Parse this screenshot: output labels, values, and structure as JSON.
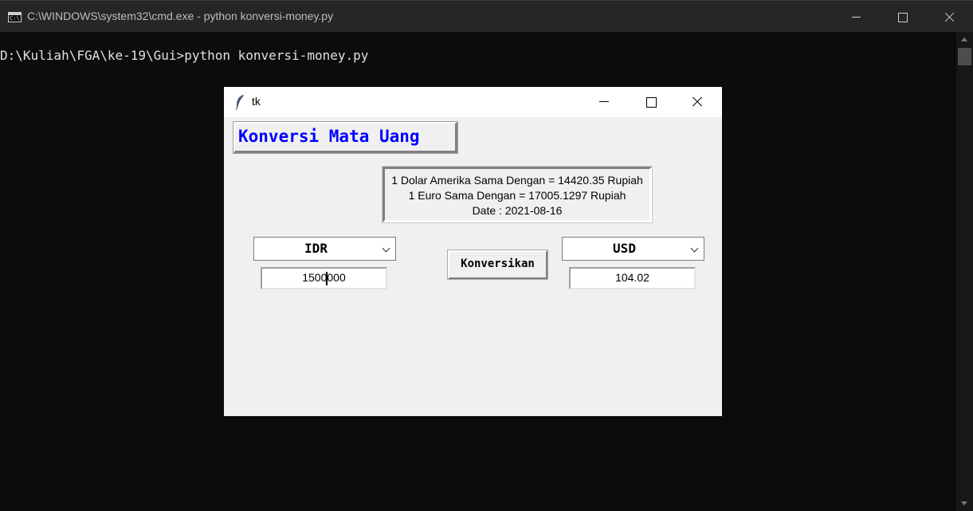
{
  "cmd": {
    "title": "C:\\WINDOWS\\system32\\cmd.exe - python  konversi-money.py",
    "icon_text": "C:\\.",
    "prompt_line": "D:\\Kuliah\\FGA\\ke-19\\Gui>python konversi-money.py"
  },
  "tk": {
    "title": "tk",
    "heading": "Konversi Mata Uang",
    "heading_color": "#0000ff",
    "info": {
      "line1": "1 Dolar Amerika Sama Dengan = 14420.35 Rupiah",
      "line2": "1 Euro Sama Dengan = 17005.1297 Rupiah",
      "line3": "Date : 2021-08-16"
    },
    "from_currency": "IDR",
    "to_currency": "USD",
    "amount_input": "1500000",
    "result_output": "104.02",
    "convert_button": "Konversikan"
  }
}
